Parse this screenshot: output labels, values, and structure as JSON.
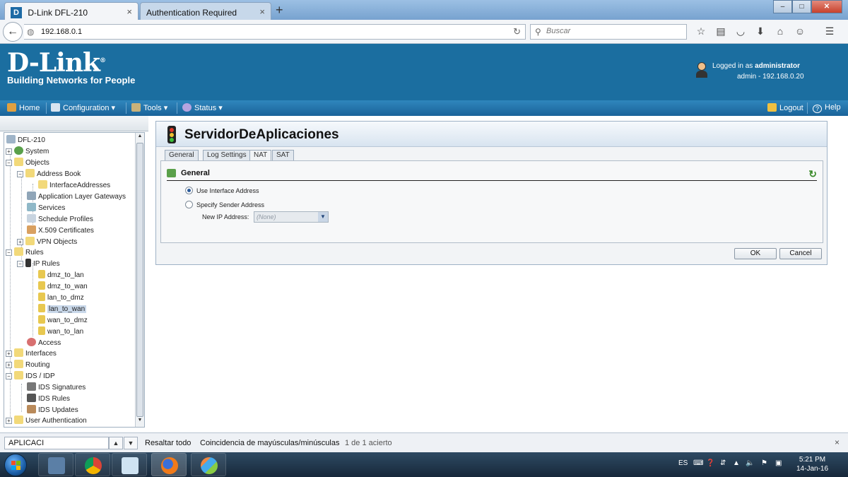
{
  "browser": {
    "tabs": [
      {
        "label": "D-Link DFL-210",
        "favicon": "D",
        "close": "×"
      },
      {
        "label": "Authentication Required",
        "close": "×"
      }
    ],
    "new_tab": "+",
    "window_controls": {
      "minimize": "‒",
      "maximize": "□",
      "close": "✕"
    },
    "url": "192.168.0.1",
    "search_placeholder": "Buscar",
    "toolbar_icons": [
      "star-icon",
      "reading-list-icon",
      "pocket-icon",
      "download-icon",
      "home-icon",
      "chat-icon",
      "menu-icon"
    ]
  },
  "header": {
    "logo_text": "D-Link",
    "logo_reg": "®",
    "tagline": "Building Networks for People",
    "logged_in_prefix": "Logged in as ",
    "logged_in_user": "administrator",
    "session": "admin - 192.168.0.20",
    "brand_color": "#1b6ea0"
  },
  "menu": {
    "home": "Home",
    "configuration": "Configuration",
    "tools": "Tools",
    "status": "Status",
    "logout": "Logout",
    "help": "Help"
  },
  "tree": {
    "root": "DFL-210",
    "system": "System",
    "objects": "Objects",
    "address_book": "Address Book",
    "interface_addresses": "InterfaceAddresses",
    "alg": "Application Layer Gateways",
    "services": "Services",
    "schedule_profiles": "Schedule Profiles",
    "x509": "X.509 Certificates",
    "vpn_objects": "VPN Objects",
    "rules": "Rules",
    "ip_rules": "IP Rules",
    "rule_items": [
      "dmz_to_lan",
      "dmz_to_wan",
      "lan_to_dmz",
      "lan_to_wan",
      "wan_to_dmz",
      "wan_to_lan"
    ],
    "selected": "lan_to_wan",
    "access": "Access",
    "interfaces": "Interfaces",
    "routing": "Routing",
    "ids_idp": "IDS / IDP",
    "ids_signatures": "IDS Signatures",
    "ids_rules": "IDS Rules",
    "ids_updates": "IDS Updates",
    "user_auth": "User Authentication",
    "toggle_plus": "+",
    "toggle_minus": "−"
  },
  "panel": {
    "title": "ServidorDeAplicaciones",
    "tabs": [
      "General",
      "Log Settings",
      "NAT",
      "SAT"
    ],
    "active_tab": "NAT",
    "section_title": "General",
    "option_use_interface": "Use Interface Address",
    "option_specify_sender": "Specify Sender Address",
    "selected_option": "Use Interface Address",
    "new_ip_label": "New IP Address:",
    "new_ip_value": "(None)",
    "ok": "OK",
    "cancel": "Cancel"
  },
  "findbar": {
    "query": "APLICACI",
    "up": "▲",
    "down": "▼",
    "highlight_all": "Resaltar todo",
    "match_case": "Coincidencia de mayúsculas/minúsculas",
    "result": "1 de 1 acierto",
    "close": "×"
  },
  "taskbar": {
    "language": "ES",
    "time": "5:21 PM",
    "date": "14-Jan-16",
    "apps": [
      "network-app-icon",
      "chrome-icon",
      "notepad-icon",
      "firefox-icon",
      "paint-icon"
    ]
  }
}
